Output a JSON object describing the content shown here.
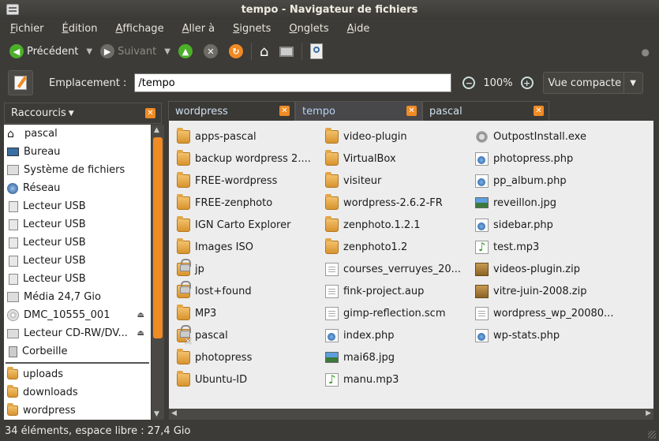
{
  "window": {
    "title": "tempo - Navigateur de fichiers"
  },
  "menu": [
    "Fichier",
    "Édition",
    "Affichage",
    "Aller à",
    "Signets",
    "Onglets",
    "Aide"
  ],
  "toolbar": {
    "back_label": "Précédent",
    "forward_label": "Suivant"
  },
  "location": {
    "label": "Emplacement :",
    "value": "/tempo",
    "zoom": "100%",
    "view_mode": "Vue compacte"
  },
  "sidebar": {
    "title": "Raccourcis",
    "items": [
      {
        "label": "pascal",
        "icon": "home-icon"
      },
      {
        "label": "Bureau",
        "icon": "desktop-icon"
      },
      {
        "label": "Système de fichiers",
        "icon": "drive-icon"
      },
      {
        "label": "Réseau",
        "icon": "network-icon"
      },
      {
        "label": "Lecteur USB",
        "icon": "usb-icon"
      },
      {
        "label": "Lecteur USB",
        "icon": "usb-icon"
      },
      {
        "label": "Lecteur USB",
        "icon": "usb-icon"
      },
      {
        "label": "Lecteur USB",
        "icon": "usb-icon"
      },
      {
        "label": "Lecteur USB",
        "icon": "usb-icon"
      },
      {
        "label": "Média 24,7 Gio",
        "icon": "drive-icon"
      },
      {
        "label": "DMC_10555_001",
        "icon": "cd-icon",
        "eject": true
      },
      {
        "label": "Lecteur CD-RW/DV...",
        "icon": "cdrom-icon",
        "eject": true
      },
      {
        "label": "Corbeille",
        "icon": "trash-icon"
      }
    ],
    "bookmarks": [
      {
        "label": "uploads",
        "icon": "folder-icon"
      },
      {
        "label": "downloads",
        "icon": "folder-icon"
      },
      {
        "label": "wordpress",
        "icon": "folder-icon"
      }
    ]
  },
  "tabs": [
    {
      "label": "wordpress"
    },
    {
      "label": "tempo",
      "active": true
    },
    {
      "label": "pascal"
    }
  ],
  "files": {
    "col1": [
      {
        "name": "apps-pascal",
        "type": "folder"
      },
      {
        "name": "backup wordpress 2....",
        "type": "folder"
      },
      {
        "name": "FREE-wordpress",
        "type": "folder"
      },
      {
        "name": "FREE-zenphoto",
        "type": "folder"
      },
      {
        "name": "IGN Carto Explorer",
        "type": "folder"
      },
      {
        "name": "Images ISO",
        "type": "folder"
      },
      {
        "name": "jp",
        "type": "folder-locked"
      },
      {
        "name": "lost+found",
        "type": "folder-locked"
      },
      {
        "name": "MP3",
        "type": "folder"
      },
      {
        "name": "pascal",
        "type": "folder-noaccess"
      },
      {
        "name": "photopress",
        "type": "folder"
      },
      {
        "name": "Ubuntu-ID",
        "type": "folder"
      }
    ],
    "col2": [
      {
        "name": "video-plugin",
        "type": "folder"
      },
      {
        "name": "VirtualBox",
        "type": "folder"
      },
      {
        "name": "visiteur",
        "type": "folder"
      },
      {
        "name": "wordpress-2.6.2-FR",
        "type": "folder"
      },
      {
        "name": "zenphoto.1.2.1",
        "type": "folder"
      },
      {
        "name": "zenphoto1.2",
        "type": "folder"
      },
      {
        "name": "courses_verruyes_20...",
        "type": "doc"
      },
      {
        "name": "fink-project.aup",
        "type": "doc"
      },
      {
        "name": "gimp-reflection.scm",
        "type": "doc"
      },
      {
        "name": "index.php",
        "type": "php"
      },
      {
        "name": "mai68.jpg",
        "type": "img"
      },
      {
        "name": "manu.mp3",
        "type": "audio"
      }
    ],
    "col3": [
      {
        "name": "OutpostInstall.exe",
        "type": "exe"
      },
      {
        "name": "photopress.php",
        "type": "php"
      },
      {
        "name": "pp_album.php",
        "type": "php"
      },
      {
        "name": "reveillon.jpg",
        "type": "img"
      },
      {
        "name": "sidebar.php",
        "type": "php"
      },
      {
        "name": "test.mp3",
        "type": "audio"
      },
      {
        "name": "videos-plugin.zip",
        "type": "zip"
      },
      {
        "name": "vitre-juin-2008.zip",
        "type": "zip"
      },
      {
        "name": "wordpress_wp_20080...",
        "type": "doc"
      },
      {
        "name": "wp-stats.php",
        "type": "php"
      }
    ]
  },
  "status": {
    "text": "34 éléments, espace libre : 27,4 Gio"
  }
}
